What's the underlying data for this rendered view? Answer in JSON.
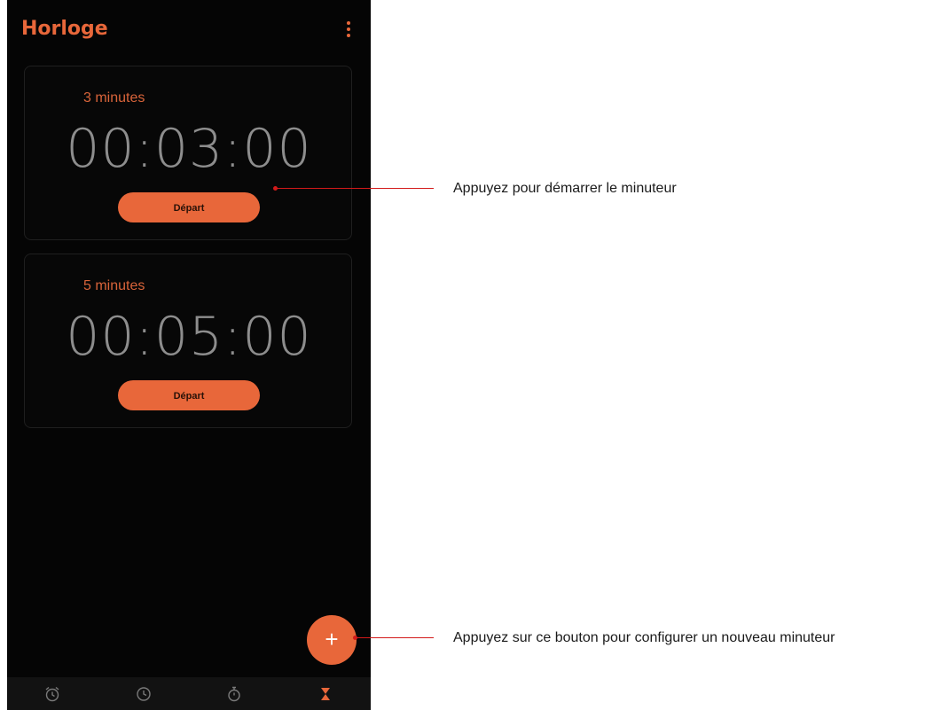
{
  "app": {
    "title": "Horloge"
  },
  "timers": [
    {
      "label": "3 minutes",
      "time": "00:03:00",
      "start_label": "Départ"
    },
    {
      "label": "5 minutes",
      "time": "00:05:00",
      "start_label": "Départ"
    }
  ],
  "fab": {
    "label": "+"
  },
  "nav": {
    "items": [
      "alarm-icon",
      "clock-icon",
      "stopwatch-icon",
      "timer-icon"
    ],
    "active": "timer-icon"
  },
  "annotations": {
    "start_callout": "Appuyez pour démarrer le minuteur",
    "add_callout": "Appuyez sur ce bouton pour configurer un nouveau minuteur"
  },
  "colors": {
    "accent": "#e8673a",
    "background": "#050505",
    "callout": "#d21a1a"
  }
}
